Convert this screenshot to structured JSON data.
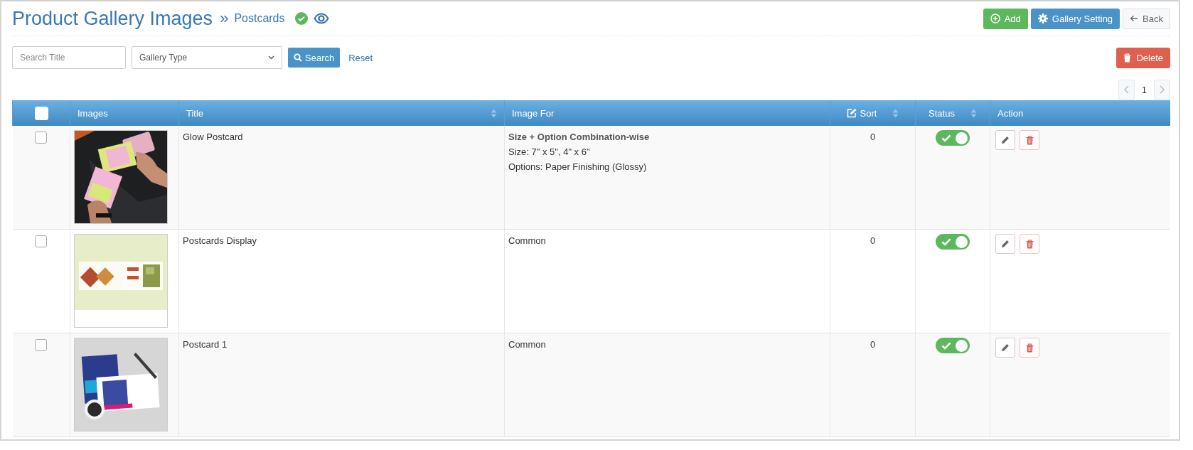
{
  "header": {
    "title": "Product Gallery Images",
    "separator": "»",
    "subtitle": "Postcards",
    "verified": true
  },
  "buttons": [
    {
      "kind": "add",
      "label": "Add"
    },
    {
      "kind": "settings",
      "label": "Gallery Setting"
    },
    {
      "kind": "back",
      "label": "Back"
    }
  ],
  "filters": {
    "search": {
      "placeholder": "Search Title"
    },
    "gallery_type": {
      "value": "Gallery Type"
    },
    "search_button": "Search",
    "reset": "Reset"
  },
  "delete_button": "Delete",
  "pagination": {
    "page": "1"
  },
  "table": {
    "select_all": {
      "checked": false
    },
    "columns": [
      {
        "label": "Images",
        "sortable": false,
        "icon": false
      },
      {
        "label": "Title",
        "sortable": true,
        "icon": false
      },
      {
        "label": "Image For",
        "sortable": false,
        "icon": false
      },
      {
        "label": "Sort",
        "sortable": true,
        "icon": true
      },
      {
        "label": "Status",
        "sortable": true,
        "icon": false
      },
      {
        "label": "Action",
        "sortable": false,
        "icon": false
      }
    ],
    "rows": [
      {
        "checked": false,
        "title": "Glow Postcard",
        "image_for": [
          {
            "kind": "heading",
            "text": "Size + Option Combination-wise"
          },
          {
            "kind": "text",
            "text": "Size: 7\" x 5\", 4\" x 6\""
          },
          {
            "kind": "text",
            "text": "Options: Paper Finishing (Glossy)"
          }
        ],
        "sort": "0",
        "status_on": true
      },
      {
        "checked": false,
        "title": "Postcards Display",
        "image_for": [
          {
            "kind": "text",
            "text": "Common"
          }
        ],
        "sort": "0",
        "status_on": true
      },
      {
        "checked": false,
        "title": "Postcard 1",
        "image_for": [
          {
            "kind": "text",
            "text": "Common"
          }
        ],
        "sort": "0",
        "status_on": true
      }
    ]
  }
}
